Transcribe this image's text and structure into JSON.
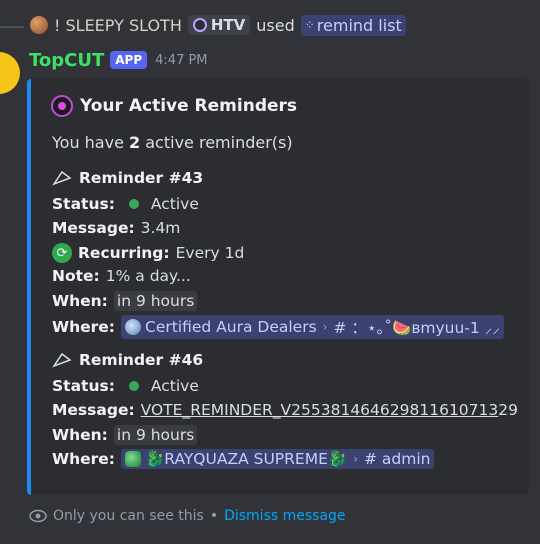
{
  "reply": {
    "user_name": "! SLEEPY SLOTH",
    "tag": "HTV",
    "used_text": "used",
    "command": "remind list"
  },
  "message": {
    "bot_name": "TopCUT",
    "app_badge": "APP",
    "timestamp": "4:47 PM"
  },
  "embed": {
    "accent_color": "#1d8bf1",
    "title": "Your Active Reminders",
    "summary_prefix": "You have",
    "summary_count": "2",
    "summary_suffix": "active reminder(s)",
    "reminders": [
      {
        "heading": "Reminder #43",
        "status_label": "Status:",
        "status_value": "Active",
        "message_label": "Message:",
        "message_value": "3.4m",
        "recurring_label": "Recurring:",
        "recurring_value": "Every 1d",
        "note_label": "Note:",
        "note_value": "1% a day...",
        "when_label": "When:",
        "when_value": "in 9 hours",
        "where_label": "Where:",
        "where_server": "Certified Aura Dealers",
        "where_channel": "# ：⋆｡˚🍉ʙmyuu-1 ⸝⸝"
      },
      {
        "heading": "Reminder #46",
        "status_label": "Status:",
        "status_value": "Active",
        "message_label": "Message:",
        "message_value": "VOTE_REMINDER_V2553814646298116107",
        "message_value_2": "13",
        "message_value_3": "29",
        "when_label": "When:",
        "when_value": "in 9 hours",
        "where_label": "Where:",
        "where_server": "🐉RAYQUAZA SUPREME🐉",
        "where_channel": "# admin"
      }
    ]
  },
  "footer": {
    "visibility_text": "Only you can see this",
    "separator": "•",
    "dismiss_text": "Dismiss message"
  }
}
